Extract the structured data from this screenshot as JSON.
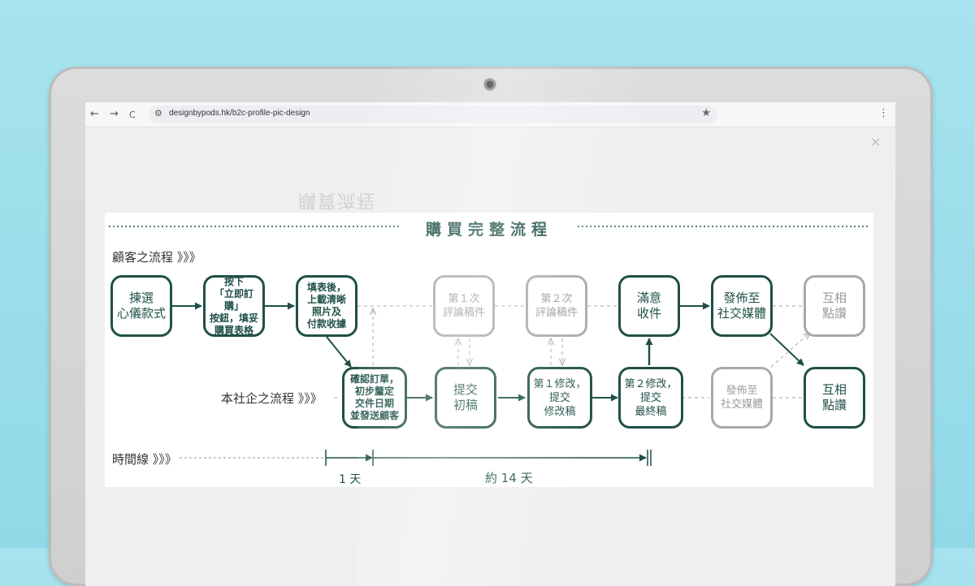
{
  "browser": {
    "back_icon": "←",
    "forward_icon": "→",
    "reload_icon": "C",
    "site_info_icon": "⚙",
    "url": "designbypods.hk/b2c-profile-pic-design",
    "bookmark_icon": "★",
    "menu_icon": "⋮"
  },
  "page": {
    "close_icon": "×",
    "background_title": "購買流程"
  },
  "diagram": {
    "title": "購買完整流程",
    "customer_lane_label": "顧客之流程 》》》",
    "company_lane_label": "本社企之流程 》》》",
    "timeline_label": "時間線 》》》",
    "customer_nodes": [
      {
        "label": "揀選\n心儀款式",
        "state": "active"
      },
      {
        "label": "按下\n「立即訂購」\n按鈕，填妥\n購買表格",
        "state": "active"
      },
      {
        "label": "填表後，\n上載清晰\n照片及\n付款收據",
        "state": "active"
      },
      {
        "label": "第１次\n評論稿件",
        "state": "inactive"
      },
      {
        "label": "第２次\n評論稿件",
        "state": "inactive"
      },
      {
        "label": "滿意\n收件",
        "state": "active"
      },
      {
        "label": "發佈至\n社交媒體",
        "state": "active"
      },
      {
        "label": "互相\n點讚",
        "state": "inactive"
      }
    ],
    "company_nodes": [
      {
        "label": "確認訂單，\n初步釐定\n交件日期\n並發送顧客",
        "state": "active"
      },
      {
        "label": "提交\n初稿",
        "state": "active"
      },
      {
        "label": "第１修改，\n提交\n修改稿",
        "state": "active"
      },
      {
        "label": "第２修改，\n提交\n最終稿",
        "state": "active"
      },
      {
        "label": "發佈至\n社交媒體",
        "state": "inactive"
      },
      {
        "label": "互相\n點讚",
        "state": "active"
      }
    ],
    "timeline": {
      "segment_1_label": "1 天",
      "segment_2_label": "約 14 天"
    },
    "colors": {
      "active": "#1f5048",
      "inactive": "#a9a9a9"
    }
  }
}
